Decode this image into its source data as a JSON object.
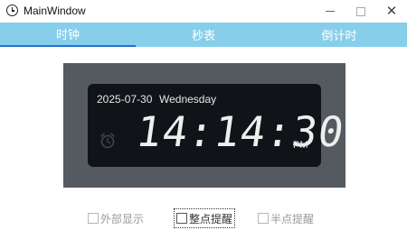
{
  "window": {
    "title": "MainWindow",
    "minimize_icon": "minimize-icon",
    "maximize_icon": "maximize-icon",
    "close_icon": "close-icon"
  },
  "tabs": [
    {
      "label": "时钟",
      "active": true
    },
    {
      "label": "秒表",
      "active": false
    },
    {
      "label": "倒计时",
      "active": false
    }
  ],
  "clock": {
    "date": "2025-07-30",
    "weekday": "Wednesday",
    "time": "14:14:30",
    "ampm": "PM",
    "alarm_icon": "alarm-clock-icon"
  },
  "options": [
    {
      "label": "外部显示",
      "checked": false
    },
    {
      "label": "整点提醒",
      "checked": false,
      "focused": true
    },
    {
      "label": "半点提醒",
      "checked": false
    }
  ],
  "colors": {
    "tab_bar": "#87ceeb",
    "tab_active_underline": "#1e6fd9",
    "clock_frame": "#545a60",
    "clock_panel": "#101418"
  }
}
